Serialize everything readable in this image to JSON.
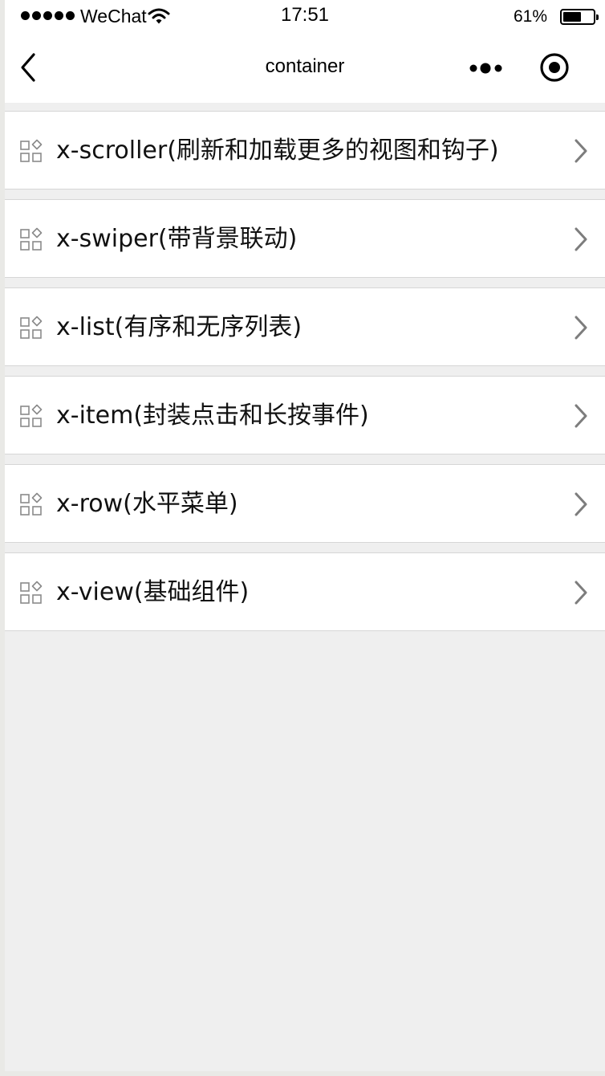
{
  "status_bar": {
    "carrier": "WeChat",
    "time": "17:51",
    "battery_percent": "61%",
    "battery_level": 0.61
  },
  "nav": {
    "title": "container",
    "icons": {
      "back": "chevron-left-icon",
      "more": "more-dots-icon",
      "record": "target-icon"
    }
  },
  "list": {
    "items": [
      {
        "label": "x-scroller(刷新和加载更多的视图和钩子)",
        "icon": "apps-grid-icon"
      },
      {
        "label": "x-swiper(带背景联动)",
        "icon": "apps-grid-icon"
      },
      {
        "label": "x-list(有序和无序列表)",
        "icon": "apps-grid-icon"
      },
      {
        "label": "x-item(封装点击和长按事件)",
        "icon": "apps-grid-icon"
      },
      {
        "label": "x-row(水平菜单)",
        "icon": "apps-grid-icon"
      },
      {
        "label": "x-view(基础组件)",
        "icon": "apps-grid-icon"
      }
    ]
  },
  "colors": {
    "background": "#efefef",
    "surface": "#ffffff",
    "divider": "#d6d6d6",
    "icon_gray": "#8a8a8a",
    "text": "#111111"
  }
}
